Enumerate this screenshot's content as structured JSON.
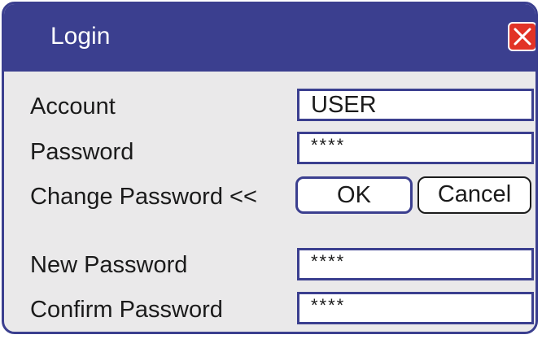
{
  "window": {
    "title": "Login",
    "close_icon": "close-x-icon"
  },
  "form": {
    "account_label": "Account",
    "account_value": "USER",
    "password_label": "Password",
    "password_value": "****",
    "change_password_label": "Change Password <<",
    "new_password_label": "New Password",
    "new_password_value": "****",
    "confirm_password_label": "Confirm Password",
    "confirm_password_value": "****"
  },
  "buttons": {
    "ok_label": "OK",
    "cancel_label": "Cancel"
  },
  "colors": {
    "titlebar": "#3b3f8f",
    "background": "#eae9ea",
    "close_button": "#e23326",
    "field_border": "#3b3f8f"
  }
}
